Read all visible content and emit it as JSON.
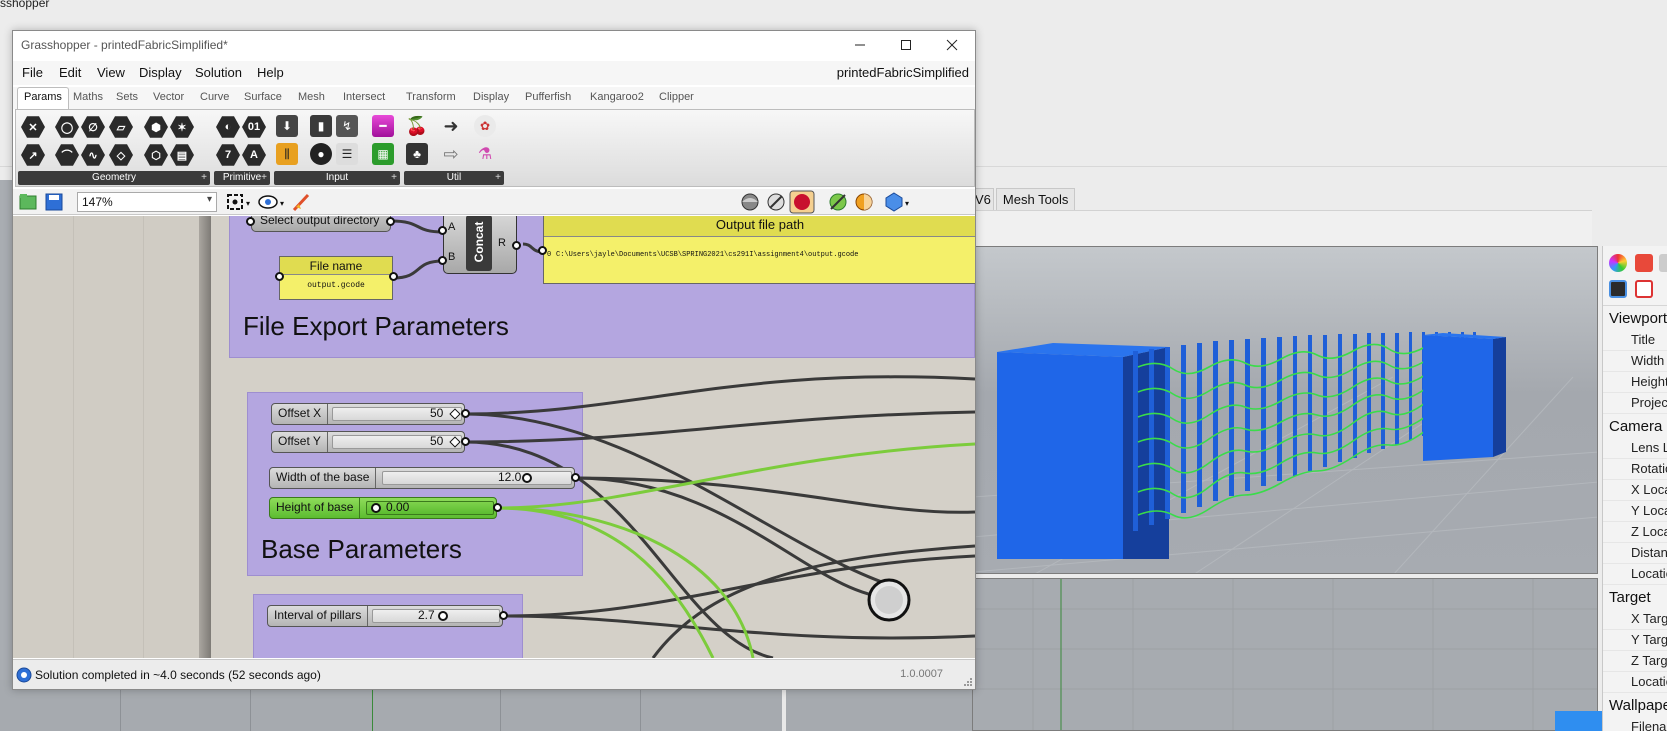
{
  "rhino": {
    "top_title": "sshopper",
    "tabs": [
      "V6",
      "Mesh Tools"
    ],
    "properties": {
      "viewport_section": "Viewport",
      "viewport_rows": [
        "Title",
        "Width",
        "Height",
        "Project"
      ],
      "camera_section": "Camera",
      "camera_rows": [
        "Lens Le",
        "Rotatio",
        "X Locat",
        "Y Locat",
        "Z Locat",
        "Distanc",
        "Locatio"
      ],
      "target_section": "Target",
      "target_rows": [
        "X Targe",
        "Y Targe",
        "Z Targe",
        "Locatio"
      ],
      "wallpaper_section": "Wallpape",
      "wallpaper_rows": [
        "Filenan"
      ]
    }
  },
  "gh": {
    "title": "Grasshopper - printedFabricSimplified*",
    "doc_name": "printedFabricSimplified",
    "menu": [
      "File",
      "Edit",
      "View",
      "Display",
      "Solution",
      "Help"
    ],
    "tabs": [
      "Params",
      "Maths",
      "Sets",
      "Vector",
      "Curve",
      "Surface",
      "Mesh",
      "Intersect",
      "Transform",
      "Display",
      "Pufferfish",
      "Kangaroo2",
      "Clipper"
    ],
    "ribbon_groups": [
      "Geometry",
      "Primitive",
      "Input",
      "Util"
    ],
    "ribbon_plus": "+",
    "zoom": "147%",
    "status": "Solution completed in ~4.0 seconds (52 seconds ago)",
    "version": "1.0.0007",
    "canvas": {
      "select_dir": "Select output directory",
      "file_name_title": "File name",
      "file_name_value": "output.gcode",
      "concat": "Concat",
      "concat_in_a": "A",
      "concat_in_b": "B",
      "concat_out": "R",
      "output_path_title": "Output file path",
      "output_path_index": "0",
      "output_path_value": "C:\\Users\\jayle\\Documents\\UCSB\\SPRING2021\\cs291I\\assignment4\\output.gcode",
      "file_group_title": "File Export Parameters",
      "base_group_title": "Base Parameters",
      "sliders": [
        {
          "label": "Offset X",
          "value": "50"
        },
        {
          "label": "Offset Y",
          "value": "50"
        },
        {
          "label": "Width of the base",
          "value": "12.0"
        },
        {
          "label": "Height of base",
          "value": "0.00"
        },
        {
          "label": "Interval of pillars",
          "value": "2.7"
        }
      ]
    }
  },
  "colors": {
    "group": "#b4a6e0",
    "panel": "#f4f06a",
    "wire_dark": "#3c3c3c",
    "wire_green": "#7ccc3c",
    "model_blue": "#1f5fd8",
    "mesh_green": "#3adc4a"
  }
}
